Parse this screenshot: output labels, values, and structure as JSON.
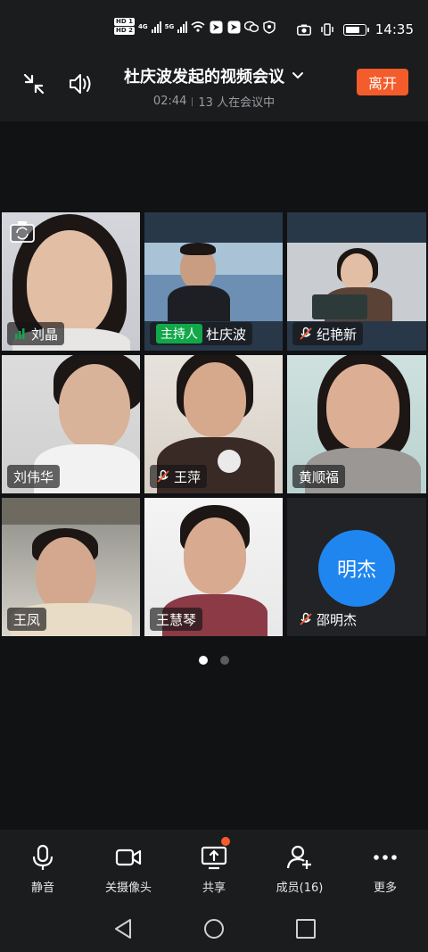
{
  "status_bar": {
    "hd1": "HD 1",
    "hd2": "HD 2",
    "net1": "4G",
    "net2": "5G",
    "time": "14:35",
    "battery_level": 0.8
  },
  "header": {
    "title": "杜庆波发起的视频会议",
    "duration": "02:44",
    "participants_text": "13 人在会议中",
    "leave_label": "离开"
  },
  "participants": [
    {
      "name": "刘晶",
      "mic": "active"
    },
    {
      "name": "杜庆波",
      "host_badge": "主持人",
      "mic": "none"
    },
    {
      "name": "纪艳新",
      "mic": "muted"
    },
    {
      "name": "刘伟华",
      "mic": "none"
    },
    {
      "name": "王萍",
      "mic": "muted"
    },
    {
      "name": "黄顺福",
      "mic": "none"
    },
    {
      "name": "王凤",
      "mic": "none"
    },
    {
      "name": "王慧琴",
      "mic": "none"
    },
    {
      "name": "邵明杰",
      "mic": "muted",
      "avatar_text": "明杰",
      "avatar_color": "#1f86f0"
    }
  ],
  "pager": {
    "pages": 2,
    "current": 1
  },
  "toolbar": {
    "mute": "静音",
    "camera_off": "关摄像头",
    "share": "共享",
    "members": "成员(16)",
    "more": "更多"
  },
  "colors": {
    "accent": "#f45c2c",
    "host_green": "#12a84a",
    "avatar_blue": "#1f86f0",
    "background": "#111214"
  }
}
